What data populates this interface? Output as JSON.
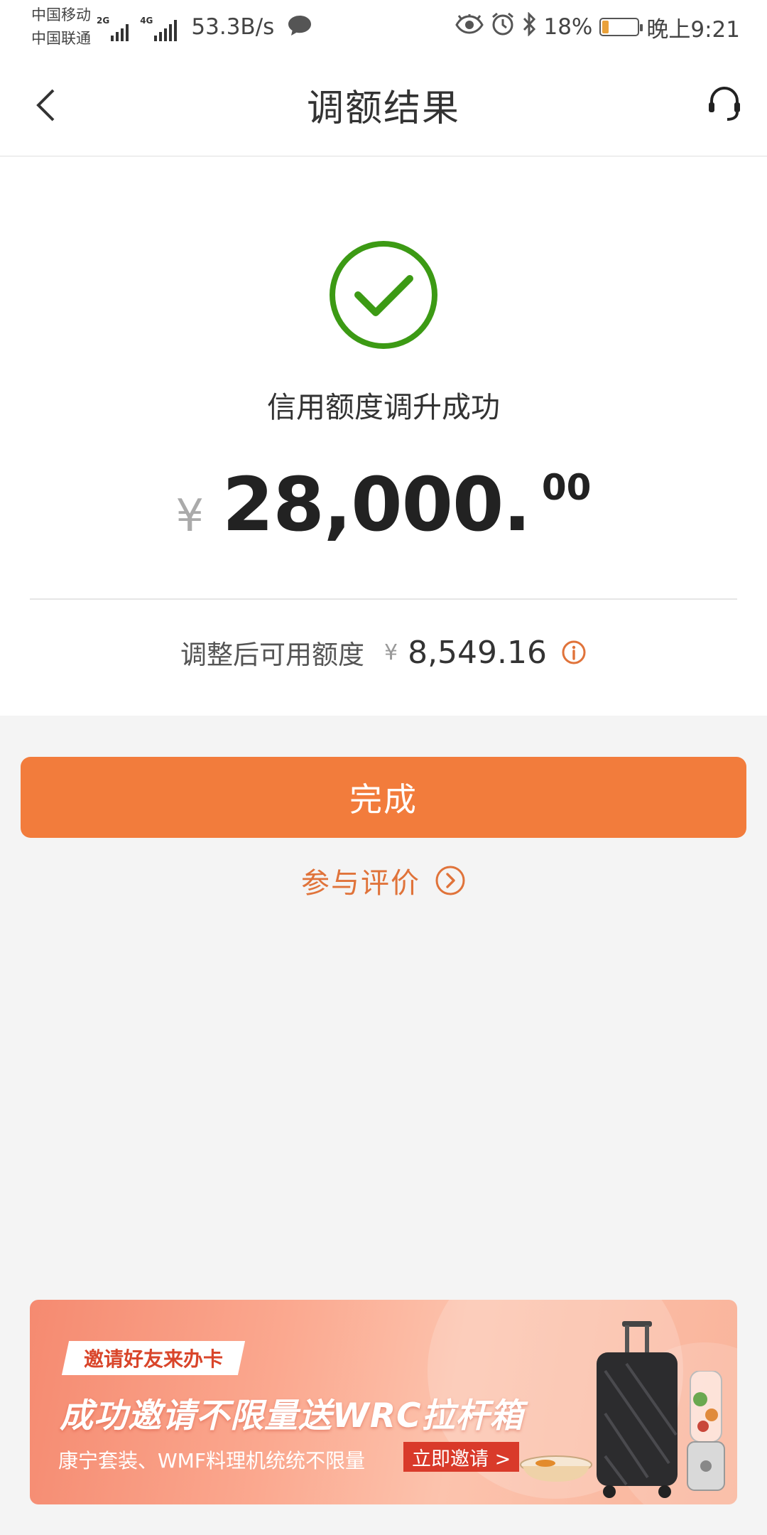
{
  "status_bar": {
    "carrier_1": "中国移动",
    "carrier_2": "中国联通",
    "signal_1_tag": "2G",
    "signal_2_tag": "4G",
    "net_speed": "53.3B/s",
    "battery_percent": "18%",
    "battery_level": 0.18,
    "time": "晚上9:21",
    "icons": [
      "message-icon",
      "eye-icon",
      "alarm-icon",
      "bluetooth-icon",
      "battery-icon"
    ]
  },
  "nav": {
    "title": "调额结果",
    "icons": [
      "back-icon",
      "customer-service-icon"
    ]
  },
  "result": {
    "status_icon": "success-check-icon",
    "message": "信用额度调升成功",
    "currency_symbol": "¥",
    "amount_integer": "28,000.",
    "amount_decimal": "00",
    "available_label": "调整后可用额度",
    "available_currency": "¥",
    "available_value": "8,549.16",
    "info_icon": "info-icon"
  },
  "actions": {
    "done_label": "完成",
    "feedback_label": "参与评价",
    "feedback_icon": "chevron-circle-right-icon"
  },
  "banner": {
    "tag": "邀请好友来办卡",
    "headline": "成功邀请不限量送WRC拉杆箱",
    "subtext": "康宁套装、WMF料理机统统不限量",
    "cta": "立即邀请 >"
  },
  "colors": {
    "accent": "#f27c3c",
    "success": "#3c9a14",
    "link": "#e0733a",
    "background": "#f4f4f4"
  }
}
